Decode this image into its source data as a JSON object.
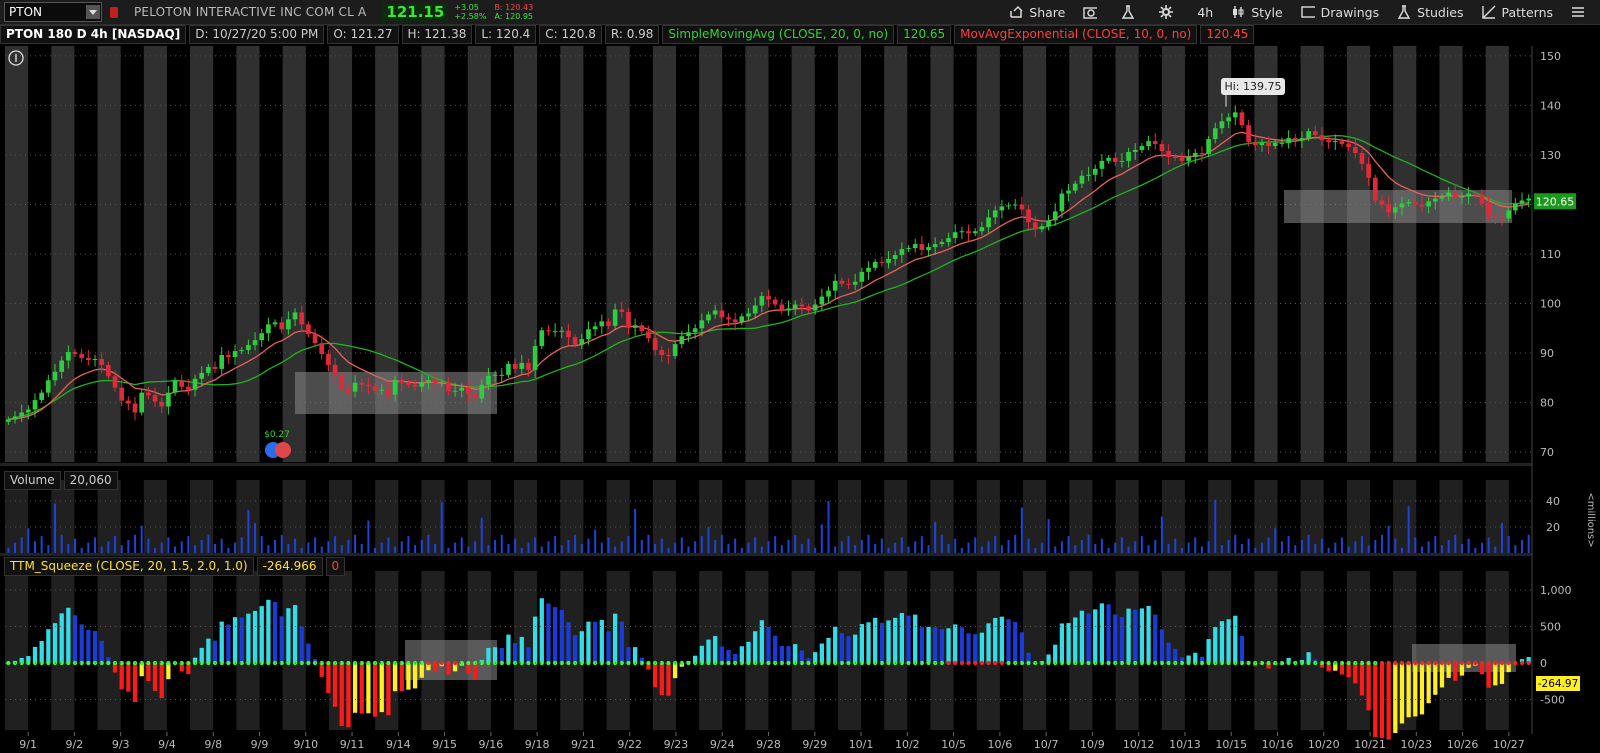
{
  "toolbar": {
    "symbol": "PTON",
    "company": "PELOTON INTERACTIVE INC COM CL A",
    "last": "121.15",
    "change": "+3.05",
    "change_pct": "+2.58%",
    "bid": "B: 120.43",
    "ask": "A: 120.95",
    "share": "Share",
    "timeframe": "4h",
    "style": "Style",
    "drawings": "Drawings",
    "studies": "Studies",
    "patterns": "Patterns"
  },
  "info": {
    "title": "PTON 180 D 4h [NASDAQ]",
    "date": "D: 10/27/20 5:00 PM",
    "open": "O: 121.27",
    "high": "H: 121.38",
    "low": "L: 120.4",
    "close": "C: 120.8",
    "range": "R: 0.98",
    "sma_label": "SimpleMovingAvg (CLOSE, 20, 0, no)",
    "sma_value": "120.65",
    "ema_label": "MovAvgExponential (CLOSE, 10, 0, no)",
    "ema_value": "120.45"
  },
  "price_panel": {
    "hi_label": "Hi: 139.75",
    "last_tag": "120.65",
    "dividend_label": "$0.27",
    "y_ticks": [
      "150",
      "140",
      "130",
      "120",
      "110",
      "100",
      "90",
      "80",
      "70"
    ]
  },
  "volume_panel": {
    "label": "Volume",
    "value": "20,060",
    "y_ticks": [
      "40",
      "20"
    ],
    "unit": "<millions>"
  },
  "squeeze_panel": {
    "label": "TTM_Squeeze (CLOSE, 20, 1.5, 2.0, 1.0)",
    "value": "-264.966",
    "signal": "0",
    "y_ticks": [
      "1,000",
      "500",
      "0",
      "-500"
    ],
    "last_tag": "-264.97"
  },
  "x_axis": [
    "9/1",
    "9/2",
    "9/3",
    "9/4",
    "9/8",
    "9/9",
    "9/10",
    "9/11",
    "9/14",
    "9/15",
    "9/16",
    "9/18",
    "9/21",
    "9/22",
    "9/23",
    "9/24",
    "9/28",
    "9/29",
    "10/1",
    "10/2",
    "10/5",
    "10/6",
    "10/7",
    "10/9",
    "10/12",
    "10/13",
    "10/15",
    "10/16",
    "10/20",
    "10/21",
    "10/23",
    "10/26",
    "10/27"
  ],
  "colors": {
    "up": "#2ecc40",
    "down": "#e02a3a",
    "sma": "#1fb31f",
    "ema": "#e8605a",
    "cyan": "#33dde8",
    "blue": "#1a3bd6",
    "red": "#ff1a1a",
    "yellow": "#ffee22",
    "dot_green": "#33ff33",
    "dot_red": "#ff2020"
  },
  "chart_data": {
    "type": "candlestick",
    "title": "PTON 180 D 4h [NASDAQ]",
    "y_range": [
      68,
      152
    ],
    "hi": 139.75,
    "closes": [
      76.6,
      77.2,
      78.0,
      78.6,
      80.5,
      82.0,
      84.5,
      86.2,
      88.5,
      90.2,
      89.8,
      89.0,
      88.6,
      88.8,
      87.6,
      85.3,
      83.0,
      80.4,
      79.8,
      78.0,
      82.0,
      81.5,
      80.2,
      79.2,
      82.0,
      84.5,
      83.2,
      82.6,
      84.8,
      86.0,
      87.2,
      86.8,
      89.6,
      89.2,
      90.4,
      90.6,
      91.6,
      92.6,
      94.0,
      95.8,
      96.2,
      94.8,
      96.8,
      98.2,
      95.8,
      93.8,
      92.0,
      89.8,
      87.6,
      85.6,
      82.6,
      82.2,
      84.0,
      83.6,
      83.3,
      82.4,
      82.6,
      81.6,
      84.6,
      84.0,
      83.6,
      83.2,
      84.1,
      84.5,
      83.8,
      84.0,
      82.3,
      82.4,
      83.0,
      81.7,
      80.8,
      83.6,
      85.4,
      85.6,
      85.6,
      87.8,
      86.8,
      88.0,
      86.6,
      91.4,
      94.6,
      94.4,
      94.4,
      94.5,
      93.2,
      91.7,
      92.8,
      94.8,
      95.4,
      96.4,
      95.5,
      98.8,
      98.3,
      95.1,
      95.6,
      94.4,
      93.0,
      90.6,
      89.6,
      89.4,
      91.8,
      93.4,
      94.2,
      95.0,
      96.6,
      97.8,
      98.6,
      97.2,
      96.8,
      96.2,
      97.4,
      98.0,
      99.6,
      101.5,
      100.8,
      99.8,
      98.6,
      99.0,
      99.8,
      99.4,
      98.6,
      99.8,
      101.4,
      102.6,
      104.6,
      104.0,
      103.8,
      104.4,
      106.4,
      107.2,
      108.4,
      108.2,
      109.0,
      109.8,
      111.0,
      111.2,
      112.0,
      110.8,
      111.4,
      112.0,
      112.4,
      113.2,
      114.4,
      114.6,
      114.2,
      114.6,
      115.4,
      117.4,
      118.8,
      119.6,
      119.8,
      120.0,
      119.0,
      116.4,
      115.0,
      115.6,
      116.8,
      118.6,
      122.2,
      122.8,
      124.2,
      125.8,
      126.0,
      127.2,
      128.8,
      129.4,
      128.6,
      128.8,
      130.6,
      131.0,
      131.8,
      132.8,
      132.2,
      130.8,
      129.6,
      129.4,
      128.8,
      129.6,
      130.4,
      130.2,
      133.2,
      135.4,
      136.8,
      137.6,
      138.6,
      136.0,
      132.6,
      132.0,
      132.4,
      131.8,
      132.4,
      132.4,
      133.4,
      133.0,
      133.4,
      134.8,
      134.0,
      133.0,
      132.6,
      132.8,
      132.2,
      131.6,
      130.4,
      128.2,
      125.4,
      120.8,
      120.0,
      118.4,
      119.4,
      120.2,
      120.5,
      120.0,
      119.6,
      120.6,
      121.2,
      121.6,
      122.4,
      121.4,
      121.6,
      122.2,
      122.0,
      120.2,
      117.6,
      117.4,
      117.2,
      118.8,
      120.2,
      120.8,
      121.2
    ]
  }
}
